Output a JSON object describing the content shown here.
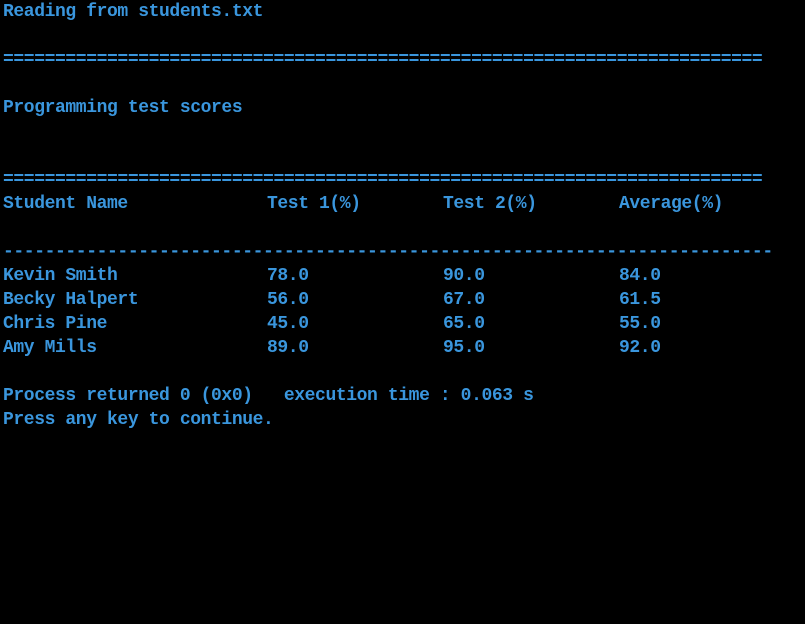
{
  "header": {
    "reading_line": "Reading from students.txt",
    "separator_equals": "=========================================================================",
    "title": "Programming test scores",
    "separator_dashes": "--------------------------------------------------------------------------"
  },
  "table": {
    "columns": [
      "Student Name",
      "Test 1(%)",
      "Test 2(%)",
      "Average(%)"
    ],
    "rows": [
      {
        "name": "Kevin Smith",
        "test1": "78.0",
        "test2": "90.0",
        "average": "84.0"
      },
      {
        "name": "Becky Halpert",
        "test1": "56.0",
        "test2": "67.0",
        "average": "61.5"
      },
      {
        "name": "Chris Pine",
        "test1": "45.0",
        "test2": "65.0",
        "average": "55.0"
      },
      {
        "name": "Amy Mills",
        "test1": "89.0",
        "test2": "95.0",
        "average": "92.0"
      }
    ]
  },
  "footer": {
    "process_line": "Process returned 0 (0x0)   execution time : 0.063 s",
    "press_line": "Press any key to continue."
  },
  "colors": {
    "background": "#000000",
    "text": "#3a96dd"
  }
}
